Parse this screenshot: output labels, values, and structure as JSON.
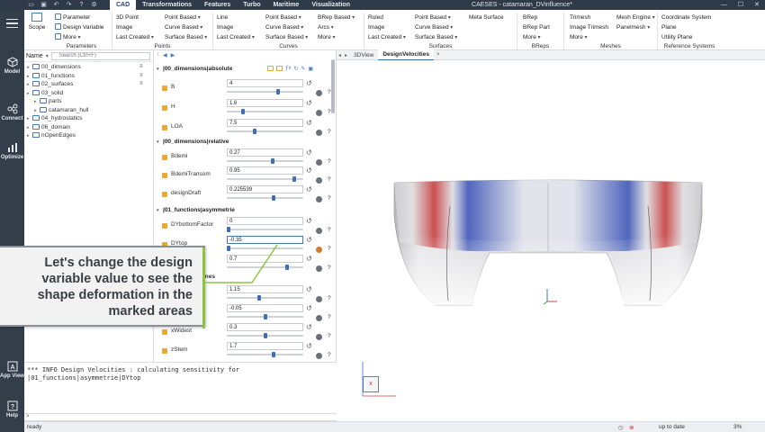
{
  "titlebar": {
    "tabs": [
      "CAD",
      "Transformations",
      "Features",
      "Turbo",
      "Maritime",
      "Visualization"
    ],
    "active_tab": "CAD",
    "window_title": "CAESES - catamaran_DVinfluence*"
  },
  "activity_bar": {
    "items": [
      "Model",
      "Connect",
      "Optimize",
      "App View",
      "Help"
    ]
  },
  "ribbon": {
    "scope": "Scope",
    "parameters": {
      "items": [
        "Parameter",
        "Design Variable",
        "More"
      ],
      "label": "Parameters"
    },
    "points": {
      "items": [
        "3D Point",
        "Image",
        "Last Created",
        "Point Based",
        "Curve Based",
        "Surface Based"
      ],
      "label": "Points"
    },
    "curves": {
      "items": [
        "Line",
        "Image",
        "Last Created",
        "Point Based",
        "Curve Based",
        "Surface Based",
        "BRep Based",
        "Arcs",
        "More"
      ],
      "label": "Curves"
    },
    "surfaces": {
      "items": [
        "Ruled",
        "Image",
        "Last Created",
        "Point Based",
        "Curve Based",
        "Surface Based",
        "Meta Surface"
      ],
      "label": "Surfaces"
    },
    "breps": {
      "items": [
        "BRep",
        "BRep Part",
        "More"
      ],
      "label": "BReps"
    },
    "meshes": {
      "items": [
        "Trimesh",
        "Image Trimesh",
        "More",
        "Mesh Engine",
        "Panelmesh"
      ],
      "label": "Meshes"
    },
    "refsys": {
      "items": [
        "Coordinate System",
        "Plane",
        "Utility Plane"
      ],
      "label": "Reference Systems"
    }
  },
  "tree": {
    "header_name": "Name",
    "search_placeholder": "Search (Ctrl+F)",
    "rows": [
      {
        "label": "00_dimensions",
        "indent": 0
      },
      {
        "label": "01_functions",
        "indent": 0
      },
      {
        "label": "02_surfaces",
        "indent": 0
      },
      {
        "label": "03_solid",
        "indent": 0
      },
      {
        "label": "parts",
        "indent": 1
      },
      {
        "label": "catamaran_hull",
        "indent": 1
      },
      {
        "label": "04_hydrostatics",
        "indent": 0
      },
      {
        "label": "06_domain",
        "indent": 0
      },
      {
        "label": "nOpenEdges",
        "indent": 0
      }
    ]
  },
  "properties": {
    "sections": [
      "|00_dimensions|absolute",
      "|00_dimensions|relative",
      "|01_functions|asymmetrie"
    ],
    "rows": [
      {
        "name": "B",
        "value": "4",
        "pos": 0.68
      },
      {
        "name": "H",
        "value": "1.6",
        "pos": 0.2
      },
      {
        "name": "LOA",
        "value": "7.5",
        "pos": 0.36
      },
      {
        "name": "Bdemi",
        "value": "0.27",
        "pos": 0.6
      },
      {
        "name": "BdemiTransom",
        "value": "0.95",
        "pos": 0.9
      },
      {
        "name": "designDraft",
        "value": "0.225539",
        "pos": 0.62
      },
      {
        "name": "DYbottomFactor",
        "value": "0",
        "pos": 0.0
      },
      {
        "name": "DYtop",
        "value": "-0.35",
        "pos": 0.0
      },
      {
        "name": "nd",
        "value": "0.7",
        "pos": 0.8
      },
      {
        "name": "ines",
        "value": "",
        "pos": -1
      },
      {
        "name": "t",
        "value": "1.15",
        "pos": 0.42
      },
      {
        "name": "ansom",
        "value": "-0.05",
        "pos": 0.5
      },
      {
        "name": "xWidest",
        "value": "0.3",
        "pos": 0.5
      },
      {
        "name": "zStem",
        "value": "1.7",
        "pos": 0.62
      }
    ]
  },
  "callout": {
    "text": "Let's change the design variable value to see the shape deformation in the marked areas"
  },
  "viewport": {
    "tabs": [
      "3DView",
      "DesignVelocities"
    ],
    "active_tab": "DesignVelocities"
  },
  "console": {
    "message": "*** INFO Design Velocities : calculating sensitivity for |01_functions|asymmetrie|DYtop"
  },
  "statusbar": {
    "left": "ready",
    "status": "up to date",
    "percent": "3%"
  }
}
